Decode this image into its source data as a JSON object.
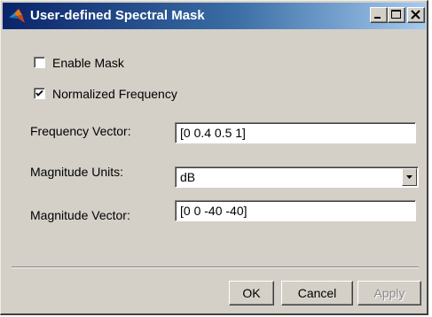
{
  "window": {
    "title": "User-defined Spectral Mask"
  },
  "form": {
    "enable_mask": {
      "label": "Enable Mask",
      "checked": false
    },
    "normalized_frequency": {
      "label": "Normalized Frequency",
      "checked": true
    },
    "frequency_vector": {
      "label": "Frequency Vector:",
      "value": "[0 0.4 0.5 1]"
    },
    "magnitude_units": {
      "label": "Magnitude Units:",
      "value": "dB"
    },
    "magnitude_vector": {
      "label": "Magnitude Vector:",
      "value": "[0 0 -40 -40]"
    }
  },
  "buttons": {
    "ok": "OK",
    "cancel": "Cancel",
    "apply": "Apply"
  },
  "icons": {
    "app": "matlab-logo-icon",
    "minimize": "minimize-icon",
    "maximize": "maximize-icon",
    "close": "close-icon",
    "check": "check-icon",
    "dropdown": "chevron-down-icon"
  },
  "colors": {
    "titlebar_start": "#0a246a",
    "titlebar_end": "#a6caf0",
    "face": "#d4d0c8"
  }
}
